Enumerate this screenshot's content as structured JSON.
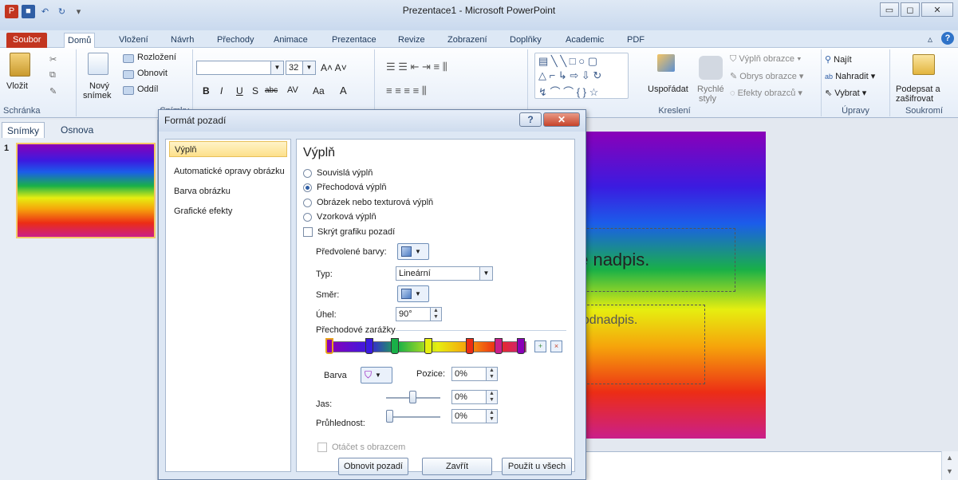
{
  "window": {
    "title": "Prezentace1 - Microsoft PowerPoint"
  },
  "tabs": [
    "Soubor",
    "Domů",
    "Vložení",
    "Návrh",
    "Přechody",
    "Animace",
    "Prezentace",
    "Revize",
    "Zobrazení",
    "Doplňky",
    "Academic",
    "PDF"
  ],
  "ribbon": {
    "clipboard": {
      "paste": "Vložit",
      "name": "Schránka"
    },
    "slides": {
      "new_slide_1": "Nový",
      "new_slide_2": "snímek",
      "layout": "Rozložení",
      "reset": "Obnovit",
      "section": "Oddíl",
      "name": "Snímky"
    },
    "font": {
      "size": "32"
    },
    "drawing": {
      "arrange": "Uspořádat",
      "quick_styles_1": "Rychlé",
      "quick_styles_2": "styly",
      "shape_fill": "Výplň obrazce",
      "shape_outline": "Obrys obrazce",
      "shape_effects": "Efekty obrazců",
      "name": "Kreslení"
    },
    "editing": {
      "find": "Najít",
      "replace": "Nahradit",
      "select": "Vybrat",
      "name": "Úpravy"
    },
    "privacy": {
      "sign_1": "Podepsat a",
      "sign_2": "zašifrovat",
      "name": "Soukromí"
    }
  },
  "left_pane": {
    "tab_slides": "Snímky",
    "tab_outline": "Osnova",
    "slide_number": "1"
  },
  "slide": {
    "title_text": "te nadpis.",
    "subtitle_text": "podnadpis."
  },
  "dialog": {
    "title": "Formát pozadí",
    "categories": [
      "Výplň",
      "Automatické opravy obrázku",
      "Barva obrázku",
      "Grafické efekty"
    ],
    "heading": "Výplň",
    "fill_options": [
      "Souvislá výplň",
      "Přechodová výplň",
      "Obrázek nebo texturová výplň",
      "Vzorková výplň"
    ],
    "selected_fill": "Přechodová výplň",
    "hide_graphics": "Skrýt grafiku pozadí",
    "preset_colors_label": "Předvolené barvy:",
    "type_label": "Typ:",
    "type_value": "Lineární",
    "direction_label": "Směr:",
    "angle_label": "Úhel:",
    "angle_value": "90°",
    "gradient_stops_label": "Přechodové zarážky",
    "color_label": "Barva",
    "position_label": "Pozice:",
    "position_value": "0%",
    "brightness_label": "Jas:",
    "brightness_value": "0%",
    "transparency_label": "Průhlednost:",
    "transparency_value": "0%",
    "rotate_with_shape": "Otáčet s obrazcem",
    "buttons": {
      "reset": "Obnovit pozadí",
      "close": "Zavřít",
      "apply_all": "Použít u všech"
    }
  },
  "colors": {
    "file_tab": "#c2351f",
    "selection": "#fde08a",
    "accent": "#2f5ea5"
  }
}
